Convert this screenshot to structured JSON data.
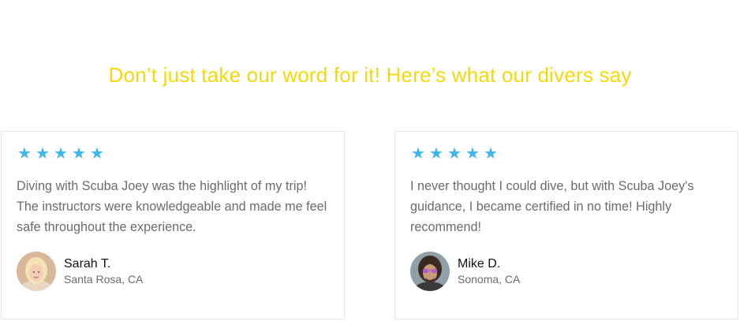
{
  "headline": "Don’t just take our word for it! Here’s what our divers say",
  "accent_color": "#f5d90a",
  "star_color": "#3fb6e8",
  "reviews": [
    {
      "rating": 5,
      "stars": [
        "★",
        "★",
        "★",
        "★",
        "★"
      ],
      "quote": "Diving with Scuba Joey was the highlight of my trip! The instructors were knowledgeable and made me feel safe throughout the experience.",
      "name": "Sarah T.",
      "location": "Santa Rosa, CA",
      "avatar_icon": "avatar-sarah"
    },
    {
      "rating": 5,
      "stars": [
        "★",
        "★",
        "★",
        "★",
        "★"
      ],
      "quote": "I never thought I could dive, but with Scuba Joey's guidance, I became certified in no time! Highly recommend!",
      "name": "Mike D.",
      "location": "Sonoma, CA",
      "avatar_icon": "avatar-mike"
    }
  ]
}
